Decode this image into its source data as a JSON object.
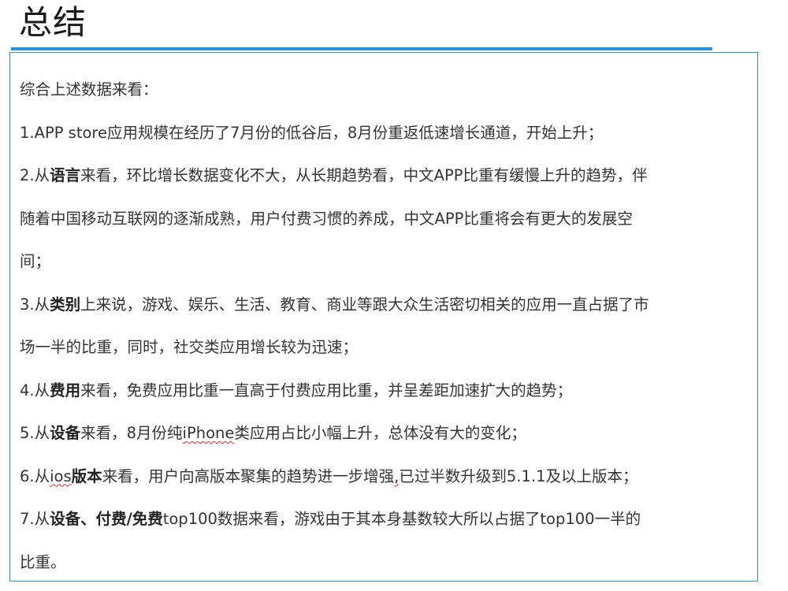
{
  "title": "总结",
  "intro": "综合上述数据来看：",
  "item1": "1.APP store应用规模在经历了7月份的低谷后，8月份重返低速增长通道，开始上升；",
  "item2": {
    "prefix": "2.从",
    "keyword": "语言",
    "line1_rest": "来看，环比增长数据变化不大，从长期趋势看，中文APP比重有缓慢上升的趋势，伴",
    "line2": "随着中国移动互联网的逐渐成熟，用户付费习惯的养成，中文APP比重将会有更大的发展空",
    "line3": "间；"
  },
  "item3": {
    "prefix": "3.从",
    "keyword": "类别",
    "line1_rest": "上来说，游戏、娱乐、生活、教育、商业等跟大众生活密切相关的应用一直占据了市",
    "line2": "场一半的比重，同时，社交类应用增长较为迅速；"
  },
  "item4": {
    "prefix": "4.从",
    "keyword": "费用",
    "rest": "来看，免费应用比重一直高于付费应用比重，并呈差距加速扩大的趋势；"
  },
  "item5": {
    "prefix": "5.从",
    "keyword": "设备",
    "middle": "来看，8月份纯",
    "device": "iPhone",
    "rest": "类应用占比小幅上升，总体没有大的变化；"
  },
  "item6": {
    "prefix": "6.从",
    "ios": "ios",
    "keyword": "版本",
    "middle": "来看，用户向高版本聚集的趋势进一步增强",
    "comma": ",",
    "rest": "已过半数升级到5.1.1及以上版本；"
  },
  "item7": {
    "prefix": "7.从",
    "keyword": "设备、付费/免费",
    "line1_rest": "top100数据来看，游戏由于其本身基数较大所以占据了top100一半的",
    "line2": "比重。"
  },
  "colors": {
    "accent": "#2a8fd8",
    "text": "#333333",
    "spellcheck": "#e03030"
  }
}
